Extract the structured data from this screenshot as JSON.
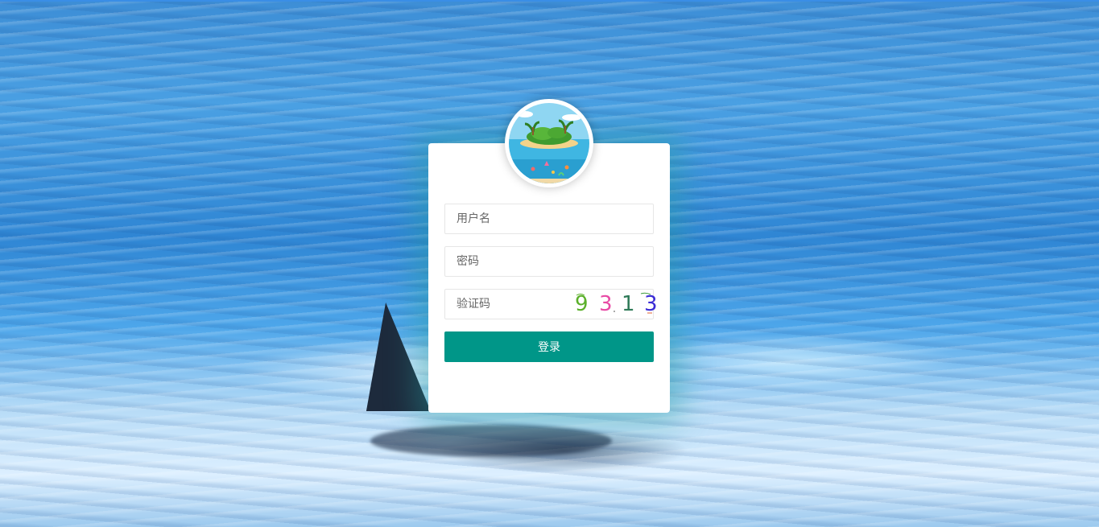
{
  "login": {
    "username_placeholder": "用户名",
    "password_placeholder": "密码",
    "captcha_placeholder": "验证码",
    "captcha_chars": [
      "9",
      "3",
      "1",
      "3"
    ],
    "captcha_colors": [
      "#5bb02a",
      "#e84aa5",
      "#2f7a58",
      "#3b2cd6"
    ],
    "submit_label": "登录"
  },
  "theme": {
    "accent": "#009688"
  },
  "icons": {
    "avatar": "island-logo"
  }
}
